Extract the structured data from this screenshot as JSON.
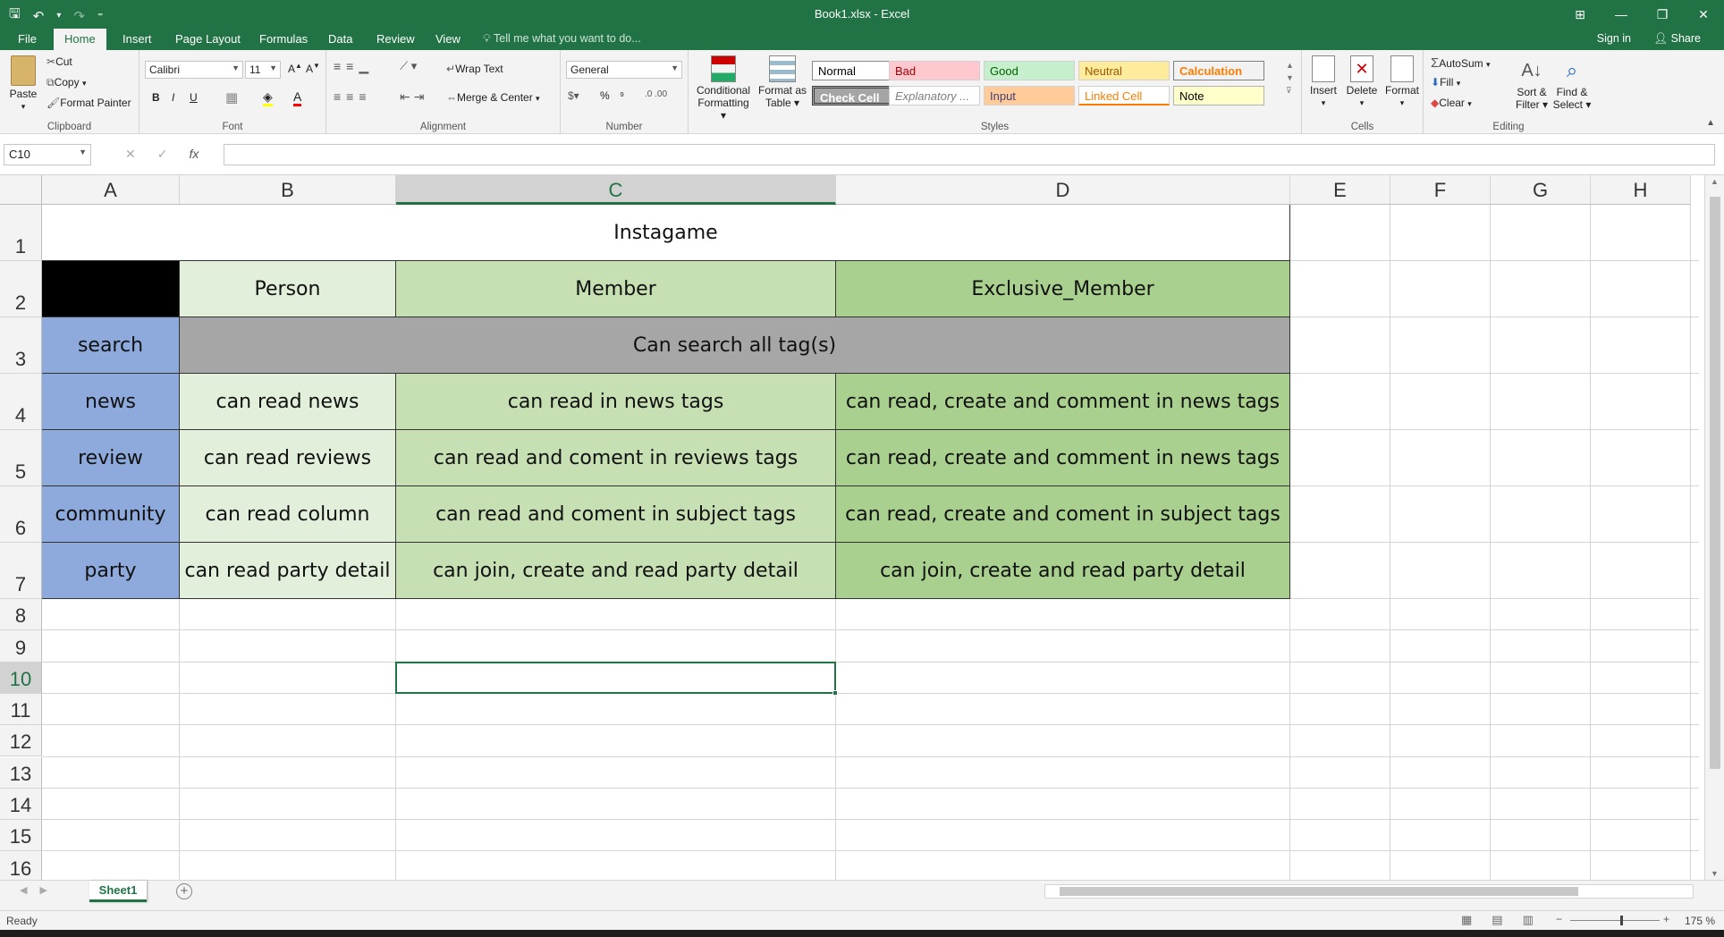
{
  "window": {
    "title": "Book1.xlsx - Excel",
    "controls": [
      "⊞",
      "—",
      "❐",
      "✕"
    ]
  },
  "qat": {
    "save": "🖫",
    "undo": "↶",
    "undo_dd": "▾",
    "redo": "↷",
    "customize": "⁼"
  },
  "tabs": [
    "File",
    "Home",
    "Insert",
    "Page Layout",
    "Formulas",
    "Data",
    "Review",
    "View"
  ],
  "tellme": "Tell me what you want to do...",
  "account": {
    "signin": "Sign in",
    "share": "Share"
  },
  "ribbon": {
    "clipboard": {
      "label": "Clipboard",
      "paste": "Paste",
      "cut": "Cut",
      "copy": "Copy",
      "painter": "Format Painter"
    },
    "font": {
      "label": "Font",
      "name": "Calibri",
      "size": "11",
      "bold": "B",
      "italic": "I",
      "underline": "U"
    },
    "alignment": {
      "label": "Alignment",
      "wrap": "Wrap Text",
      "merge": "Merge & Center"
    },
    "number": {
      "label": "Number",
      "format": "General",
      "percent": "%",
      "comma": "⁹"
    },
    "styles": {
      "label": "Styles",
      "conditional": [
        "Conditional",
        "Formatting ▾"
      ],
      "format_table": [
        "Format as",
        "Table ▾"
      ],
      "gallery": [
        {
          "name": "Normal",
          "bg": "#ffffff",
          "fg": "#000000"
        },
        {
          "name": "Bad",
          "bg": "#ffc7ce",
          "fg": "#9c0006"
        },
        {
          "name": "Good",
          "bg": "#c6efce",
          "fg": "#006100"
        },
        {
          "name": "Neutral",
          "bg": "#ffeb9c",
          "fg": "#9c5700"
        },
        {
          "name": "Calculation",
          "bg": "#f2f2f2",
          "fg": "#fa7d00"
        },
        {
          "name": "Check Cell",
          "bg": "#a5a5a5",
          "fg": "#ffffff"
        },
        {
          "name": "Explanatory ...",
          "bg": "#ffffff",
          "fg": "#7f7f7f"
        },
        {
          "name": "Input",
          "bg": "#ffcc99",
          "fg": "#3f3f76"
        },
        {
          "name": "Linked Cell",
          "bg": "#ffffff",
          "fg": "#fa7d00"
        },
        {
          "name": "Note",
          "bg": "#ffffcc",
          "fg": "#000000"
        }
      ]
    },
    "cells": {
      "label": "Cells",
      "insert": "Insert",
      "delete": "Delete",
      "format": "Format"
    },
    "editing": {
      "label": "Editing",
      "autosum": "AutoSum",
      "fill": "Fill",
      "clear": "Clear",
      "sort": [
        "Sort &",
        "Filter ▾"
      ],
      "find": [
        "Find &",
        "Select ▾"
      ]
    }
  },
  "formula_bar": {
    "name_box": "C10",
    "cancel": "✕",
    "enter": "✓",
    "fx": "fx",
    "value": ""
  },
  "columns": [
    "A",
    "B",
    "C",
    "D",
    "E",
    "F",
    "G",
    "H"
  ],
  "selected_column": "C",
  "rows": [
    "1",
    "2",
    "3",
    "4",
    "5",
    "6",
    "7",
    "8",
    "9",
    "10",
    "11",
    "12",
    "13",
    "14",
    "15",
    "16"
  ],
  "selected_row": "10",
  "colors": {
    "accent": "#217346",
    "role_blue": "#8ea9db",
    "person": "#e2efda",
    "member": "#c6e0b4",
    "exclusive": "#a9d08e",
    "gray": "#a6a6a6",
    "header_black": "#000000"
  },
  "cells": {
    "title": "Instagame",
    "headers": [
      "Person",
      "Member",
      "Exclusive_Member"
    ],
    "search": {
      "label": "search",
      "text": "Can search all tag(s)"
    },
    "data_rows": [
      {
        "label": "news",
        "person": "can read news",
        "member": "can read in news tags",
        "exclusive": "can read, create and comment in news tags"
      },
      {
        "label": "review",
        "person": "can read reviews",
        "member": "can read and coment in reviews tags",
        "exclusive": "can read, create and comment in news tags"
      },
      {
        "label": "community",
        "person": "can read column",
        "member": "can read and coment in subject tags",
        "exclusive": "can read, create and coment in subject tags"
      },
      {
        "label": "party",
        "person": "can read party detail",
        "member": "can join, create and read party detail",
        "exclusive": "can join, create and read party detail"
      }
    ]
  },
  "sheet_tabs": [
    "Sheet1"
  ],
  "status": {
    "ready": "Ready",
    "zoom": "175 %",
    "minus": "−",
    "plus": "+"
  }
}
